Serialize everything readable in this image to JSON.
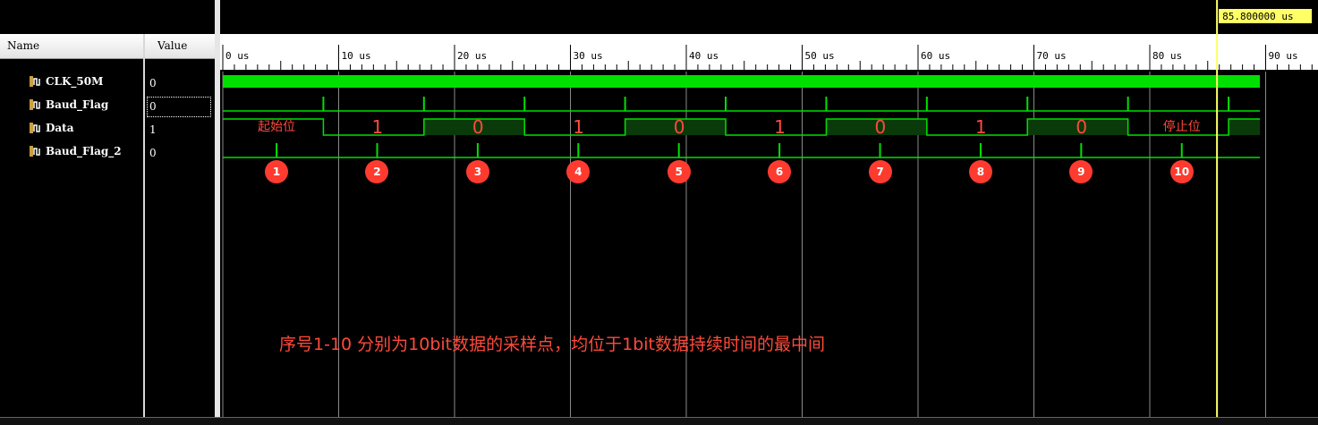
{
  "panel": {
    "col_name": "Name",
    "col_value": "Value",
    "signals": [
      {
        "name": "CLK_50M",
        "value": "0"
      },
      {
        "name": "Baud_Flag",
        "value": "0"
      },
      {
        "name": "Data",
        "value": "1"
      },
      {
        "name": "Baud_Flag_2",
        "value": "0"
      }
    ]
  },
  "cursor": {
    "time_label": "85.800000 us",
    "time_us": 85.8,
    "color": "#ffff66"
  },
  "timeline": {
    "ticks": [
      "0 us",
      "10 us",
      "20 us",
      "30 us",
      "40 us",
      "50 us",
      "60 us",
      "70 us",
      "80 us",
      "90 us"
    ]
  },
  "bit_labels": [
    "起始位",
    "1",
    "0",
    "1",
    "0",
    "1",
    "0",
    "1",
    "0",
    "停止位"
  ],
  "sample_points": [
    "1",
    "2",
    "3",
    "4",
    "5",
    "6",
    "7",
    "8",
    "9",
    "10"
  ],
  "note": "序号1-10 分别为10bit数据的采样点，均位于1bit数据持续时间的最中间",
  "colors": {
    "wave": "#00e000",
    "bus_fill": "#0a3a0a",
    "annotation": "#ff4a3a",
    "background": "#000000"
  }
}
